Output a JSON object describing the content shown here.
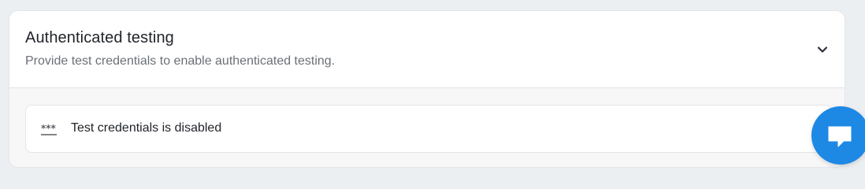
{
  "section": {
    "title": "Authenticated testing",
    "subtitle": "Provide test credentials to enable authenticated testing.",
    "toggle_icon": "chevron-down-icon",
    "expanded": true
  },
  "credentials": {
    "icon": "password-icon",
    "status_text": "Test credentials is disabled"
  },
  "chat_widget": {
    "icon": "chat-bubble-icon"
  },
  "colors": {
    "page_background": "#eceff1",
    "card_background": "#ffffff",
    "body_background": "#f7f7f8",
    "title_text": "#1f2328",
    "muted_text": "#6b7078",
    "chat_accent": "#1e88e5"
  }
}
